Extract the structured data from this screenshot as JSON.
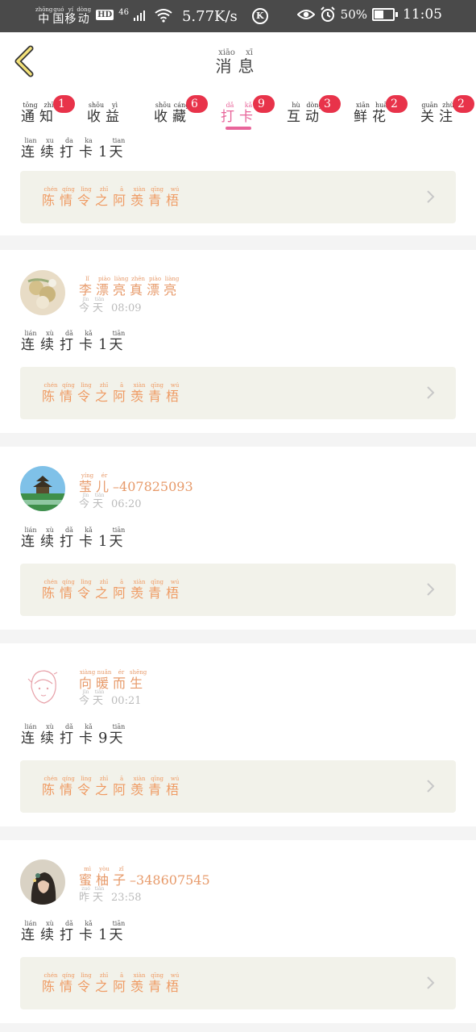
{
  "status_bar": {
    "carrier": [
      {
        "c": "中",
        "p": "zhōng"
      },
      {
        "c": "国",
        "p": "guó"
      },
      {
        "c": "移",
        "p": "yí"
      },
      {
        "c": "动",
        "p": "dòng"
      }
    ],
    "hd": "HD",
    "network": "46",
    "speed": "5.77K/s",
    "k_icon": "K",
    "battery_pct": "50%",
    "time": "11:05",
    "icons": [
      "signal-icon",
      "wifi-icon",
      "eye-icon",
      "alarm-icon",
      "battery-icon"
    ]
  },
  "header": {
    "title": [
      {
        "c": "消",
        "p": "xiāo"
      },
      {
        "c": "息",
        "p": "xī"
      }
    ],
    "back_icon": "chevron-left-icon"
  },
  "tabs": [
    {
      "chars": [
        {
          "c": "通",
          "p": "tōng"
        },
        {
          "c": "知",
          "p": "zhī"
        }
      ],
      "badge": "1"
    },
    {
      "chars": [
        {
          "c": "收",
          "p": "shōu"
        },
        {
          "c": "益",
          "p": "yì"
        }
      ],
      "badge": "6"
    },
    {
      "chars": [
        {
          "c": "收",
          "p": "shōu"
        },
        {
          "c": "藏",
          "p": "cáng"
        }
      ],
      "badge": "9"
    },
    {
      "chars": [
        {
          "c": "打",
          "p": "dǎ"
        },
        {
          "c": "卡",
          "p": "kǎ"
        }
      ],
      "badge": "3",
      "active": true
    },
    {
      "chars": [
        {
          "c": "互",
          "p": "hù"
        },
        {
          "c": "动",
          "p": "dòng"
        }
      ],
      "badge": "2"
    },
    {
      "chars": [
        {
          "c": "鲜",
          "p": "xiān"
        },
        {
          "c": "花",
          "p": "huā"
        }
      ],
      "badge": "2"
    },
    {
      "chars": [
        {
          "c": "关",
          "p": "guān"
        },
        {
          "c": "注",
          "p": "zhù"
        }
      ],
      "badge": ""
    }
  ],
  "accent_color": "#e8659a",
  "badge_color": "#e8334a",
  "feed": [
    {
      "partial": true,
      "streak": {
        "chars": [
          {
            "c": "连",
            "p": "lian"
          },
          {
            "c": "续",
            "p": "xu"
          },
          {
            "c": "打",
            "p": "da"
          },
          {
            "c": "卡",
            "p": "ka"
          }
        ],
        "num": "1",
        "unit": {
          "c": "天",
          "p": "tian"
        }
      },
      "book": [
        {
          "c": "陈",
          "p": "chén"
        },
        {
          "c": "情",
          "p": "qíng"
        },
        {
          "c": "令",
          "p": "lìng"
        },
        {
          "c": "之",
          "p": "zhī"
        },
        {
          "c": "阿",
          "p": "ā"
        },
        {
          "c": "羡",
          "p": "xiàn"
        },
        {
          "c": "青",
          "p": "qīng"
        },
        {
          "c": "梧",
          "p": "wú"
        }
      ]
    },
    {
      "avatar": "avatar-flowers",
      "name": [
        {
          "c": "李",
          "p": "lǐ"
        },
        {
          "c": "漂",
          "p": "piào"
        },
        {
          "c": "亮",
          "p": "liàng"
        },
        {
          "c": "真",
          "p": "zhēn"
        },
        {
          "c": "漂",
          "p": "piào"
        },
        {
          "c": "亮",
          "p": "liàng"
        }
      ],
      "name_suffix": "",
      "day": [
        {
          "c": "今",
          "p": "jīn"
        },
        {
          "c": "天",
          "p": "tiān"
        }
      ],
      "time": "08:09",
      "streak": {
        "chars": [
          {
            "c": "连",
            "p": "lián"
          },
          {
            "c": "续",
            "p": "xù"
          },
          {
            "c": "打",
            "p": "dǎ"
          },
          {
            "c": "卡",
            "p": "kǎ"
          }
        ],
        "num": "1",
        "unit": {
          "c": "天",
          "p": "tiān"
        }
      },
      "book": [
        {
          "c": "陈",
          "p": "chén"
        },
        {
          "c": "情",
          "p": "qíng"
        },
        {
          "c": "令",
          "p": "lìng"
        },
        {
          "c": "之",
          "p": "zhī"
        },
        {
          "c": "阿",
          "p": "ā"
        },
        {
          "c": "羡",
          "p": "xiàn"
        },
        {
          "c": "青",
          "p": "qīng"
        },
        {
          "c": "梧",
          "p": "wú"
        }
      ]
    },
    {
      "avatar": "avatar-pagoda",
      "name": [
        {
          "c": "莹",
          "p": "yíng"
        },
        {
          "c": "儿",
          "p": "ér"
        }
      ],
      "name_suffix": "–407825093",
      "day": [
        {
          "c": "今",
          "p": "jīn"
        },
        {
          "c": "天",
          "p": "tiān"
        }
      ],
      "time": "06:20",
      "streak": {
        "chars": [
          {
            "c": "连",
            "p": "lián"
          },
          {
            "c": "续",
            "p": "xù"
          },
          {
            "c": "打",
            "p": "dǎ"
          },
          {
            "c": "卡",
            "p": "kǎ"
          }
        ],
        "num": "1",
        "unit": {
          "c": "天",
          "p": "tiān"
        }
      },
      "book": [
        {
          "c": "陈",
          "p": "chén"
        },
        {
          "c": "情",
          "p": "qíng"
        },
        {
          "c": "令",
          "p": "lìng"
        },
        {
          "c": "之",
          "p": "zhī"
        },
        {
          "c": "阿",
          "p": "ā"
        },
        {
          "c": "羡",
          "p": "xiàn"
        },
        {
          "c": "青",
          "p": "qīng"
        },
        {
          "c": "梧",
          "p": "wú"
        }
      ]
    },
    {
      "avatar": "avatar-sketch-girl",
      "name": [
        {
          "c": "向",
          "p": "xiàng"
        },
        {
          "c": "暖",
          "p": "nuǎn"
        },
        {
          "c": "而",
          "p": "ér"
        },
        {
          "c": "生",
          "p": "shēng"
        }
      ],
      "name_suffix": "",
      "day": [
        {
          "c": "今",
          "p": "jīn"
        },
        {
          "c": "天",
          "p": "tiān"
        }
      ],
      "time": "00:21",
      "streak": {
        "chars": [
          {
            "c": "连",
            "p": "lián"
          },
          {
            "c": "续",
            "p": "xù"
          },
          {
            "c": "打",
            "p": "dǎ"
          },
          {
            "c": "卡",
            "p": "kǎ"
          }
        ],
        "num": "9",
        "unit": {
          "c": "天",
          "p": "tiān"
        }
      },
      "book": [
        {
          "c": "陈",
          "p": "chén"
        },
        {
          "c": "情",
          "p": "qíng"
        },
        {
          "c": "令",
          "p": "lìng"
        },
        {
          "c": "之",
          "p": "zhī"
        },
        {
          "c": "阿",
          "p": "ā"
        },
        {
          "c": "羡",
          "p": "xiàn"
        },
        {
          "c": "青",
          "p": "qīng"
        },
        {
          "c": "梧",
          "p": "wú"
        }
      ]
    },
    {
      "avatar": "avatar-girl-photo",
      "name": [
        {
          "c": "蜜",
          "p": "mì"
        },
        {
          "c": "柚",
          "p": "yòu"
        },
        {
          "c": "子",
          "p": "zǐ"
        }
      ],
      "name_suffix": "–348607545",
      "day": [
        {
          "c": "昨",
          "p": "zuó"
        },
        {
          "c": "天",
          "p": "tiān"
        }
      ],
      "time": "23:58",
      "streak": {
        "chars": [
          {
            "c": "连",
            "p": "lián"
          },
          {
            "c": "续",
            "p": "xù"
          },
          {
            "c": "打",
            "p": "dǎ"
          },
          {
            "c": "卡",
            "p": "kǎ"
          }
        ],
        "num": "1",
        "unit": {
          "c": "天",
          "p": "tiān"
        }
      },
      "book": [
        {
          "c": "陈",
          "p": "chén"
        },
        {
          "c": "情",
          "p": "qíng"
        },
        {
          "c": "令",
          "p": "lìng"
        },
        {
          "c": "之",
          "p": "zhī"
        },
        {
          "c": "阿",
          "p": "ā"
        },
        {
          "c": "羡",
          "p": "xiàn"
        },
        {
          "c": "青",
          "p": "qīng"
        },
        {
          "c": "梧",
          "p": "wú"
        }
      ]
    }
  ]
}
